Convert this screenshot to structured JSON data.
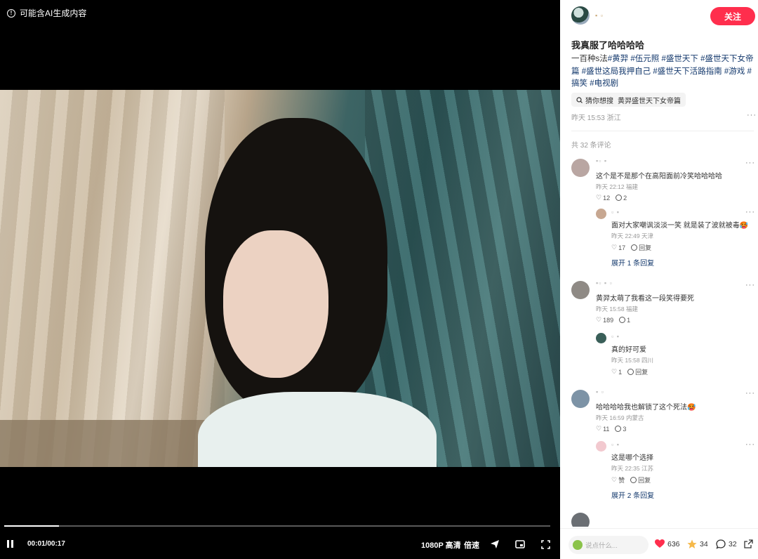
{
  "video": {
    "ai_notice": "可能含AI生成内容",
    "time": "00:01/00:17",
    "progress_fraction": 0.1,
    "quality_label": "1080P 高清",
    "speed_label": "倍速"
  },
  "post": {
    "follow_label": "关注",
    "title": "我真服了哈哈哈哈",
    "body_prefix": "一百种s法",
    "tags": [
      "#黄羿",
      "#伍元照",
      "#盛世天下",
      "#盛世天下女帝篇",
      "#盛世这局我押自己",
      "#盛世天下活路指南",
      "#游戏",
      "#搞笑",
      "#电视剧"
    ],
    "search_label": "猜你想搜",
    "search_keyword": "黄羿盛世天下女帝篇",
    "meta": "昨天 15:53 浙江",
    "more": "···"
  },
  "comments_header": "共 32 条评论",
  "comments": [
    {
      "text": "这个是不是那个在高阳面前冷笑哈哈哈哈",
      "meta": "昨天 22:12 福建",
      "likes": "12",
      "replies": "2",
      "avatar_color": "#b9a6a2"
    },
    {
      "text": "黄羿太萌了我看这一段笑得要死",
      "meta": "昨天 15:58 福建",
      "likes": "189",
      "replies": "1",
      "avatar_color": "#8f8a85"
    },
    {
      "text": "哈哈哈哈我也解锁了这个死法🥵",
      "meta": "昨天 16:59 内蒙古",
      "likes": "11",
      "replies": "3",
      "avatar_color": "#7d93a6"
    }
  ],
  "replies": [
    {
      "text": "面对大家嘲讽淡淡一笑 就是装了波就被毒🥵",
      "meta": "昨天 22:49 天津",
      "likes": "17",
      "reply_label": "回复",
      "avatar_color": "#c7a791"
    },
    {
      "text": "真的好可爱",
      "meta": "昨天 15:58 四川",
      "likes": "1",
      "reply_label": "回复",
      "avatar_color": "#3a5f59"
    },
    {
      "text": "这是哪个选择",
      "meta": "昨天 22:35 江苏",
      "likes": "赞",
      "reply_label": "回复",
      "avatar_color": "#f2c9cf"
    }
  ],
  "expand_labels": [
    "展开 1 条回复",
    "展开 2 条回复"
  ],
  "bottom": {
    "placeholder": "说点什么...",
    "likes": "636",
    "stars": "34",
    "comments": "32"
  }
}
